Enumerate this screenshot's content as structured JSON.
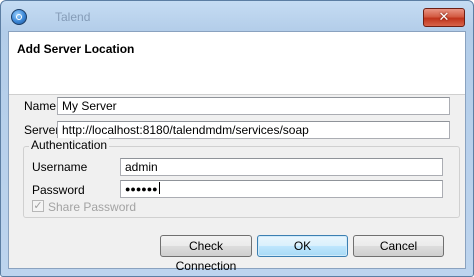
{
  "window": {
    "title": "Talend"
  },
  "header": {
    "title": "Add Server Location"
  },
  "form": {
    "name": {
      "label": "Name",
      "value": "My Server"
    },
    "server": {
      "label": "Server",
      "value": "http://localhost:8180/talendmdm/services/soap"
    }
  },
  "authentication": {
    "title": "Authentication",
    "username": {
      "label": "Username",
      "value": "admin"
    },
    "password": {
      "label": "Password",
      "masked_value": "●●●●●●"
    },
    "share_password": {
      "label": "Share Password",
      "checked": true,
      "enabled": false
    }
  },
  "buttons": {
    "check_connection": "Check Connection",
    "ok": "OK",
    "cancel": "Cancel"
  },
  "icons": {
    "close": "close-icon",
    "app": "app-icon",
    "checkmark": "checkmark-icon"
  }
}
